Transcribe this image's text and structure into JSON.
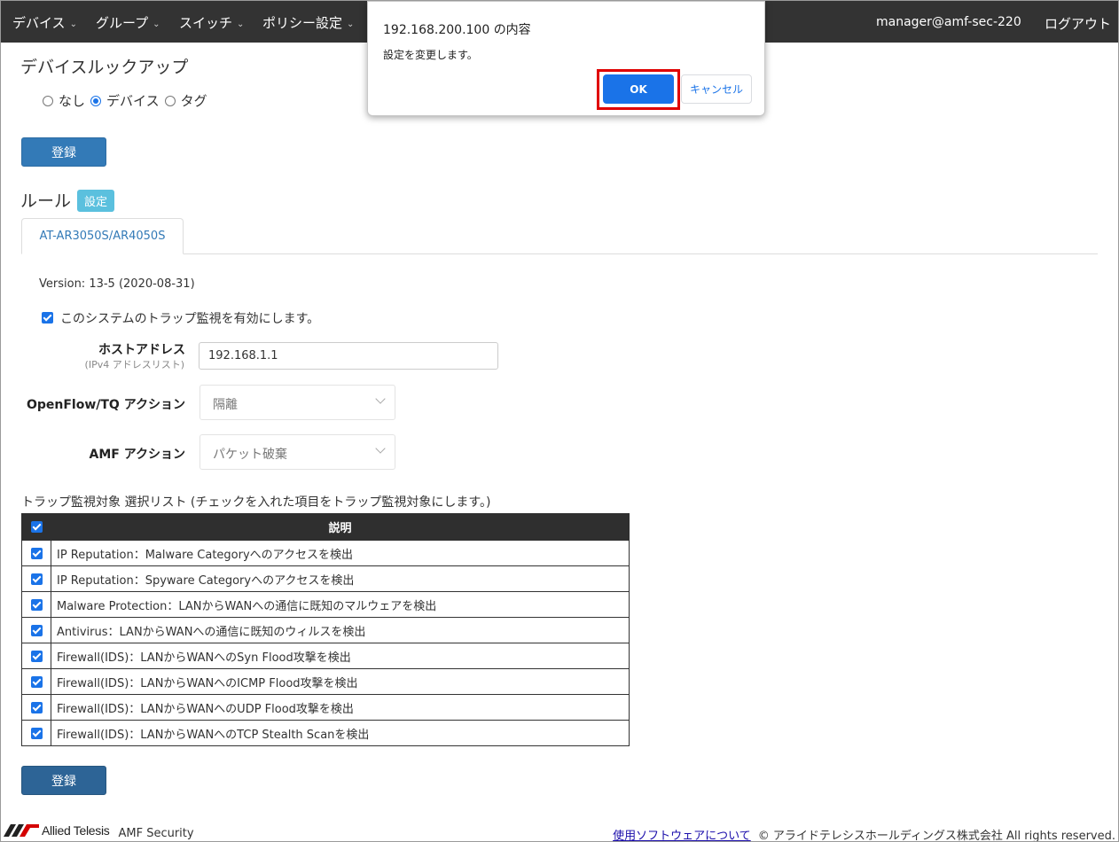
{
  "nav": {
    "items": [
      {
        "label": "デバイス"
      },
      {
        "label": "グループ"
      },
      {
        "label": "スイッチ"
      },
      {
        "label": "ポリシー設定"
      }
    ],
    "user": "manager@amf-sec-220",
    "logout": "ログアウト"
  },
  "lookup": {
    "title": "デバイスルックアップ",
    "options": [
      "なし",
      "デバイス",
      "タグ"
    ],
    "selected": "デバイス",
    "register_label": "登録"
  },
  "rule": {
    "title": "ルール",
    "setting_badge": "設定",
    "tab": "AT-AR3050S/AR4050S",
    "version": "Version: 13-5 (2020-08-31)",
    "enable_label": "このシステムのトラップ監視を有効にします。",
    "enable_checked": true,
    "host_label": "ホストアドレス",
    "host_sublabel": "(IPv4 アドレスリスト)",
    "host_value": "192.168.1.1",
    "openflow_label": "OpenFlow/TQ アクション",
    "openflow_value": "隔離",
    "amf_label": "AMF アクション",
    "amf_value": "パケット破棄",
    "list_caption": "トラップ監視対象 選択リスト (チェックを入れた項目をトラップ監視対象にします。)",
    "table_header": "説明",
    "rows": [
      {
        "text": "IP Reputation：Malware Categoryへのアクセスを検出",
        "checked": true
      },
      {
        "text": "IP Reputation：Spyware Categoryへのアクセスを検出",
        "checked": true
      },
      {
        "text": "Malware Protection：LANからWANへの通信に既知のマルウェアを検出",
        "checked": true
      },
      {
        "text": "Antivirus：LANからWANへの通信に既知のウィルスを検出",
        "checked": true
      },
      {
        "text": "Firewall(IDS)：LANからWANへのSyn Flood攻撃を検出",
        "checked": true
      },
      {
        "text": "Firewall(IDS)：LANからWANへのICMP Flood攻撃を検出",
        "checked": true
      },
      {
        "text": "Firewall(IDS)：LANからWANへのUDP Flood攻撃を検出",
        "checked": true
      },
      {
        "text": "Firewall(IDS)：LANからWANへのTCP Stealth Scanを検出",
        "checked": true
      }
    ],
    "register_label": "登録"
  },
  "footer": {
    "brand": "Allied Telesis",
    "product": "AMF Security",
    "link": "使用ソフトウェアについて",
    "copyright": "© アライドテレシスホールディングス株式会社 All rights reserved."
  },
  "dialog": {
    "title": "192.168.200.100 の内容",
    "message": "設定を変更します。",
    "ok": "OK",
    "cancel": "キャンセル"
  },
  "colors": {
    "navbar": "#333333",
    "primary": "#337ab7",
    "dialog_accent": "#1a73e8",
    "highlight": "#e00000",
    "badge": "#5bc0de"
  }
}
